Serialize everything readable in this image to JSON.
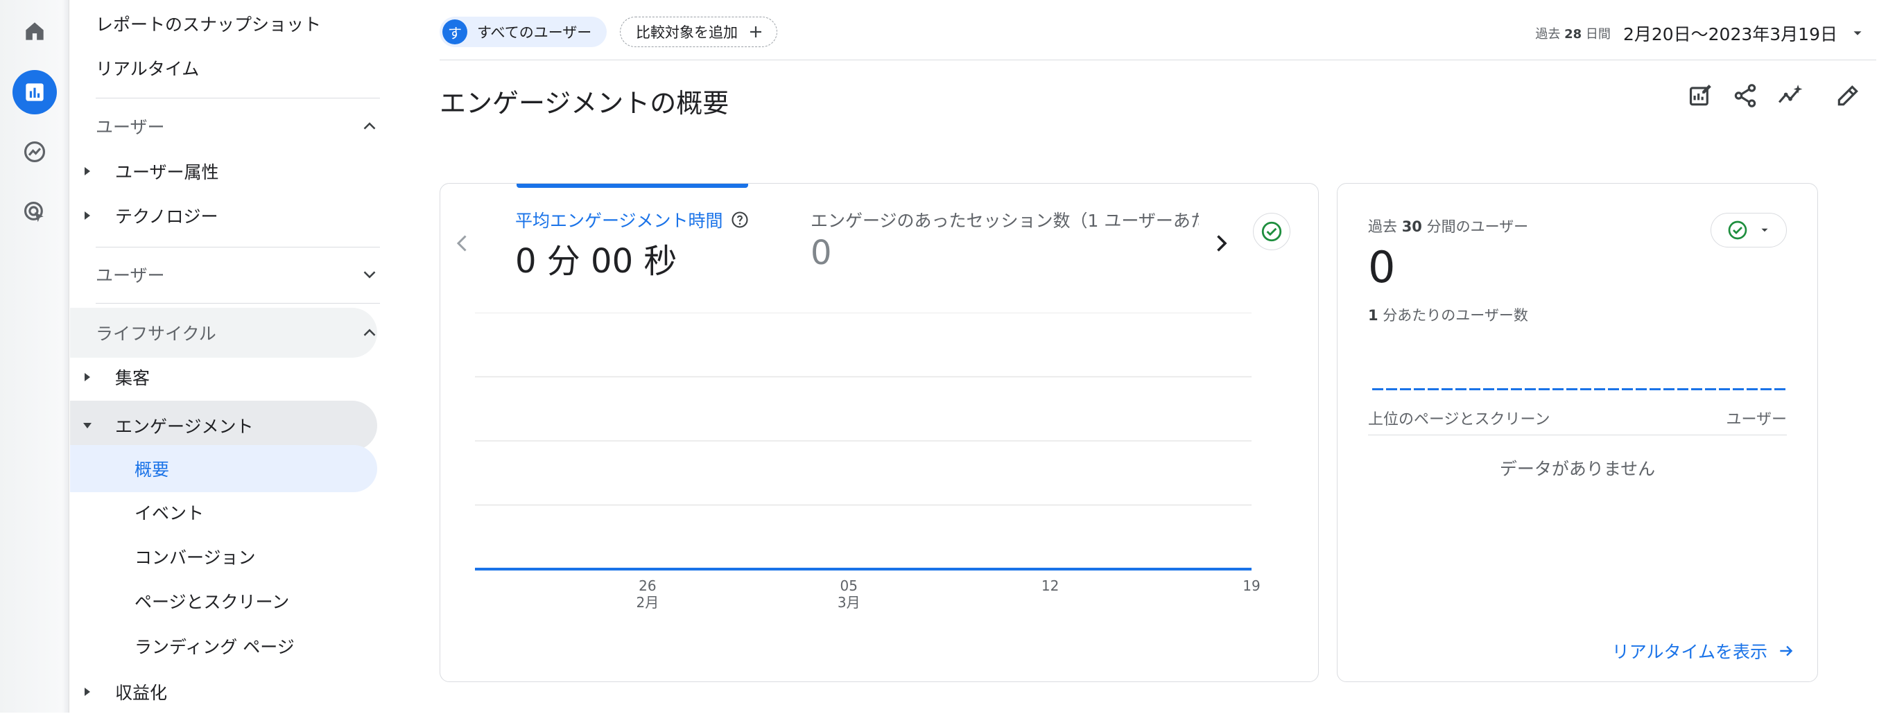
{
  "nav": {
    "snapshot": "レポートのスナップショット",
    "realtime": "リアルタイム",
    "section_user_1": "ユーザー",
    "user_attributes": "ユーザー属性",
    "technology": "テクノロジー",
    "section_user_2": "ユーザー",
    "section_lifecycle": "ライフサイクル",
    "acquisition": "集客",
    "engagement": "エンゲージメント",
    "overview": "概要",
    "events": "イベント",
    "conversions": "コンバージョン",
    "pages_screens": "ページとスクリーン",
    "landing_page": "ランディング ページ",
    "monetization": "収益化"
  },
  "header": {
    "segment_avatar": "す",
    "segment_label": "すべてのユーザー",
    "add_comparison": "比較対象を追加",
    "date_prefix_a": "過去 ",
    "date_prefix_b": "28",
    "date_prefix_c": " 日間",
    "date_range": "2月20日〜2023年3月19日",
    "page_title": "エンゲージメントの概要"
  },
  "main_card": {
    "metric1_label": "平均エンゲージメント時間",
    "metric1_value": "0 分 00 秒",
    "metric2_label": "エンゲージのあったセッション数（1 ユーザーあた",
    "metric2_value": "0"
  },
  "chart_data": {
    "type": "line",
    "x": [
      "26 2月",
      "05 3月",
      "12",
      "19"
    ],
    "series": [
      {
        "values": [
          0,
          0,
          0,
          0
        ]
      }
    ],
    "xlabel": "",
    "ylabel": "",
    "grid": true
  },
  "chart_ticks": {
    "t1_day": "26",
    "t1_month": "2月",
    "t2_day": "05",
    "t2_month": "3月",
    "t3_day": "12",
    "t4_day": "19"
  },
  "realtime_card": {
    "label_a": "過去 ",
    "label_b": "30",
    "label_c": " 分間のユーザー",
    "value": "0",
    "sub_a": "1",
    "sub_b": " 分あたりのユーザー数",
    "col_page": "上位のページとスクリーン",
    "col_users": "ユーザー",
    "empty": "データがありません",
    "link": "リアルタイムを表示"
  },
  "colors": {
    "accent": "#1a73e8",
    "success": "#1e8e3e",
    "selected_bg": "#e8f0fe"
  }
}
